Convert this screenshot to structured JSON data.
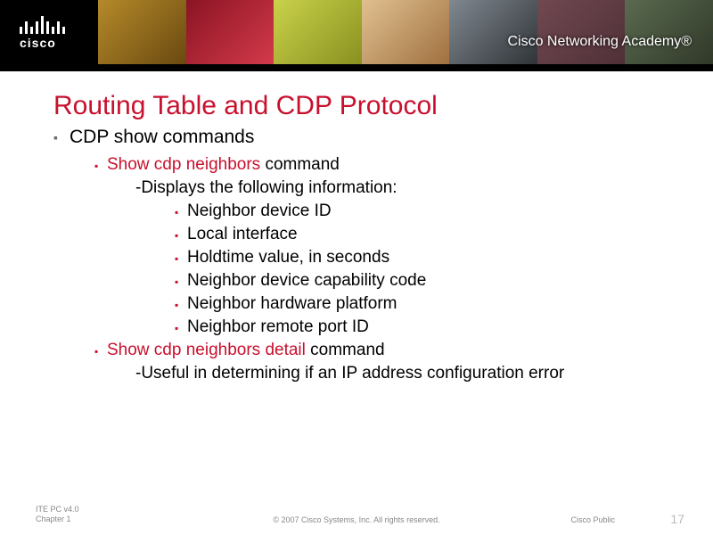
{
  "header": {
    "brand": "cisco",
    "academy": "Cisco Networking Academy®"
  },
  "slide": {
    "title": "Routing Table and CDP Protocol",
    "topic": "CDP show commands",
    "cmd1_name": "Show cdp neighbors",
    "cmd1_suffix": " command",
    "cmd1_desc": "-Displays the following information:",
    "items": {
      "i1": "Neighbor device ID",
      "i2": "Local interface",
      "i3": "Holdtime value, in seconds",
      "i4": "Neighbor device capability code",
      "i5": "Neighbor hardware platform",
      "i6": "Neighbor remote port ID"
    },
    "cmd2_name": "Show cdp neighbors detail",
    "cmd2_suffix": " command",
    "cmd2_desc": "-Useful in determining if an IP address configuration error"
  },
  "footer": {
    "left1": "ITE PC v4.0",
    "left2": "Chapter 1",
    "center": "© 2007 Cisco Systems, Inc. All rights reserved.",
    "right1": "Cisco Public",
    "pagenum": "17"
  }
}
